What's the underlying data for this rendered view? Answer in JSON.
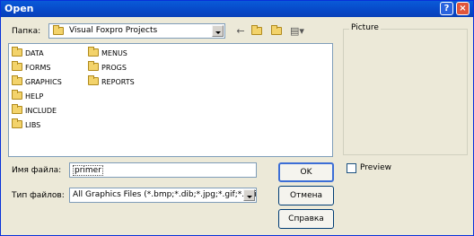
{
  "window": {
    "title": "Open",
    "help_btn": "?",
    "close_btn": "×"
  },
  "lookin": {
    "label": "Папка:",
    "value": "Visual Foxpro Projects"
  },
  "toolbar": {
    "back_icon": "back-arrow-icon",
    "up_icon": "up-folder-icon",
    "new_icon": "new-folder-icon",
    "view_icon": "view-menu-icon"
  },
  "files": [
    "DATA",
    "FORMS",
    "GRAPHICS",
    "HELP",
    "INCLUDE",
    "LIBS",
    "MENUS",
    "PROGS",
    "REPORTS"
  ],
  "filename": {
    "label": "Имя файла:",
    "value": "primer"
  },
  "filetype": {
    "label": "Тип файлов:",
    "value": "All Graphics Files (*.bmp;*.dib;*.jpg;*.gif;*.ani;"
  },
  "buttons": {
    "ok": "OK",
    "cancel": "Отмена",
    "help": "Справка"
  },
  "picture": {
    "label": "Picture"
  },
  "preview": {
    "label": "Preview",
    "checked": false
  }
}
